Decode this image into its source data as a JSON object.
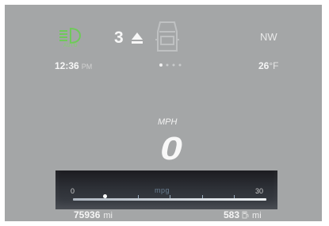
{
  "colors": {
    "background": "#a4a6a7",
    "headlight_icon": "#6fc95a",
    "text": "#f4f4f4",
    "mpg_panel": "#1f2126"
  },
  "status": {
    "headlight_mode": "AUTO",
    "headlight_icon": "auto-headlight-icon",
    "gear": "3",
    "gear_shift_icon": "shift-up-arrow-icon",
    "vehicle_icon": "vehicle-status-icon",
    "compass": "NW",
    "time": "12:36",
    "time_suffix": "PM",
    "outside_temp": "26",
    "temp_unit": "°F",
    "pages_total": 4,
    "page_current": 1
  },
  "speed": {
    "unit": "MPH",
    "value": "0"
  },
  "fuel_economy": {
    "label": "mpg",
    "scale_min": "0",
    "scale_max": "30",
    "current_mpg": 5
  },
  "trip": {
    "odometer": "75936",
    "odometer_unit": "mi",
    "range": "583",
    "range_unit": "mi",
    "fuel_icon": "fuel-pump-icon"
  }
}
